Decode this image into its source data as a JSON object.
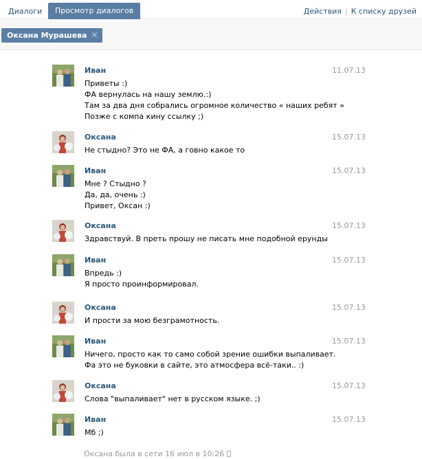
{
  "tabs": {
    "dialogs": "Диалоги",
    "view": "Просмотр диалогов"
  },
  "actions": {
    "actions_link": "Действия",
    "separator": "|",
    "friends_link": "К списку друзей"
  },
  "filter": {
    "chip_label": "Оксана Мурашева",
    "chip_close_icon": "close-icon"
  },
  "colors": {
    "accent": "#597da3",
    "link": "#2b587a",
    "muted": "#999999"
  },
  "messages": [
    {
      "author": "Иван",
      "date": "11.07.13",
      "avatar": "ivan",
      "lines": [
        "Приветы :)",
        "ФА вернулась на нашу землю.:)",
        "Там за два дня собрались огромное количество « наших ребят »",
        "Позже с компа кину ссылку ;)"
      ]
    },
    {
      "author": "Оксана",
      "date": "15.07.13",
      "avatar": "oksana",
      "lines": [
        "Не стыдно? Это не ФА, а говно какое то"
      ]
    },
    {
      "author": "Иван",
      "date": "15.07.13",
      "avatar": "ivan",
      "lines": [
        "Мне ? Стыдно ?",
        "Да, да, очень :)",
        "Привет, Оксан :)"
      ]
    },
    {
      "author": "Оксана",
      "date": "15.07.13",
      "avatar": "oksana",
      "lines": [
        "Здравствуй. В преть прошу не писать мне подобной ерунды"
      ]
    },
    {
      "author": "Иван",
      "date": "15.07.13",
      "avatar": "ivan",
      "lines": [
        "Впредь :)",
        "Я просто проинформировал."
      ]
    },
    {
      "author": "Оксана",
      "date": "15.07.13",
      "avatar": "oksana",
      "lines": [
        "И прости за мою безграмотность."
      ]
    },
    {
      "author": "Иван",
      "date": "15.07.13",
      "avatar": "ivan",
      "lines": [
        "Ничего, просто как то само собой зрение ошибки выпаливает.",
        "Фа это не буковки в сайте, это атмосфера всё-таки.. :)"
      ]
    },
    {
      "author": "Оксана",
      "date": "15.07.13",
      "avatar": "oksana",
      "lines": [
        "Слова \"выпаливает\" нет в русском языке. ;)"
      ]
    },
    {
      "author": "Иван",
      "date": "15.07.13",
      "avatar": "ivan",
      "lines": [
        "Мб ;)"
      ]
    }
  ],
  "status": {
    "text": "Оксана была в сети 16 июл в 10:26",
    "icon": "phone-icon"
  }
}
